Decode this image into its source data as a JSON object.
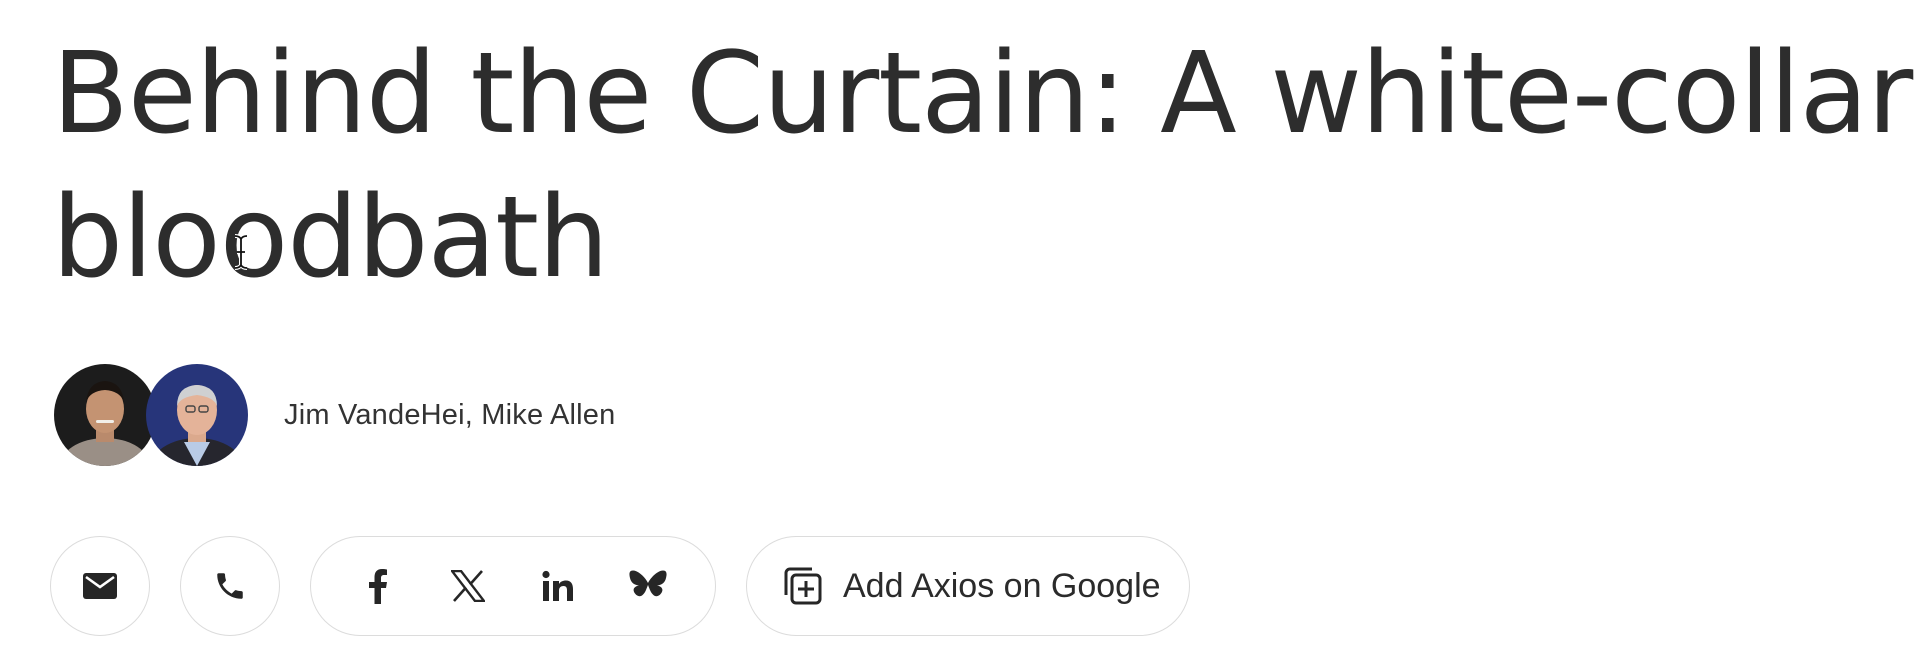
{
  "article": {
    "headline": "Behind the Curtain: A white-collar bloodbath",
    "authors": "Jim VandeHei, Mike Allen",
    "avatars": [
      {
        "icon": "author-avatar-photo",
        "bg": "#1c1c1c"
      },
      {
        "icon": "author-avatar-photo",
        "bg": "#27357a"
      }
    ]
  },
  "share": {
    "buttons": [
      {
        "icon": "email-icon"
      },
      {
        "icon": "phone-icon"
      },
      {
        "icon": "facebook-icon"
      },
      {
        "icon": "x-icon"
      },
      {
        "icon": "linkedin-icon"
      },
      {
        "icon": "bluesky-icon"
      }
    ],
    "add_google_label": "Add Axios on Google"
  },
  "colors": {
    "text": "#2d2d2d",
    "border": "#dcdcdc",
    "background": "#ffffff"
  }
}
